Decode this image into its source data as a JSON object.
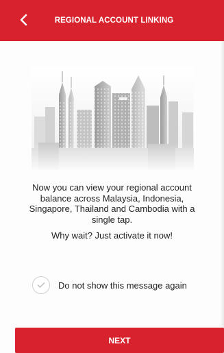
{
  "header": {
    "title": "REGIONAL ACCOUNT LINKING",
    "back_icon": "chevron-left-icon",
    "background_color": "#d8232f"
  },
  "hero": {
    "image": "city-skyline-illustration"
  },
  "message": {
    "body": "Now you can view your regional account balance across Malaysia, Indonesia, Singapore, Thailand and Cambodia with a single tap.",
    "cta_text": "Why wait? Just activate it now!"
  },
  "checkbox": {
    "label": "Do not show this message again",
    "checked": false,
    "icon": "checkmark-icon"
  },
  "footer": {
    "next_label": "NEXT",
    "button_color": "#d8232f"
  }
}
